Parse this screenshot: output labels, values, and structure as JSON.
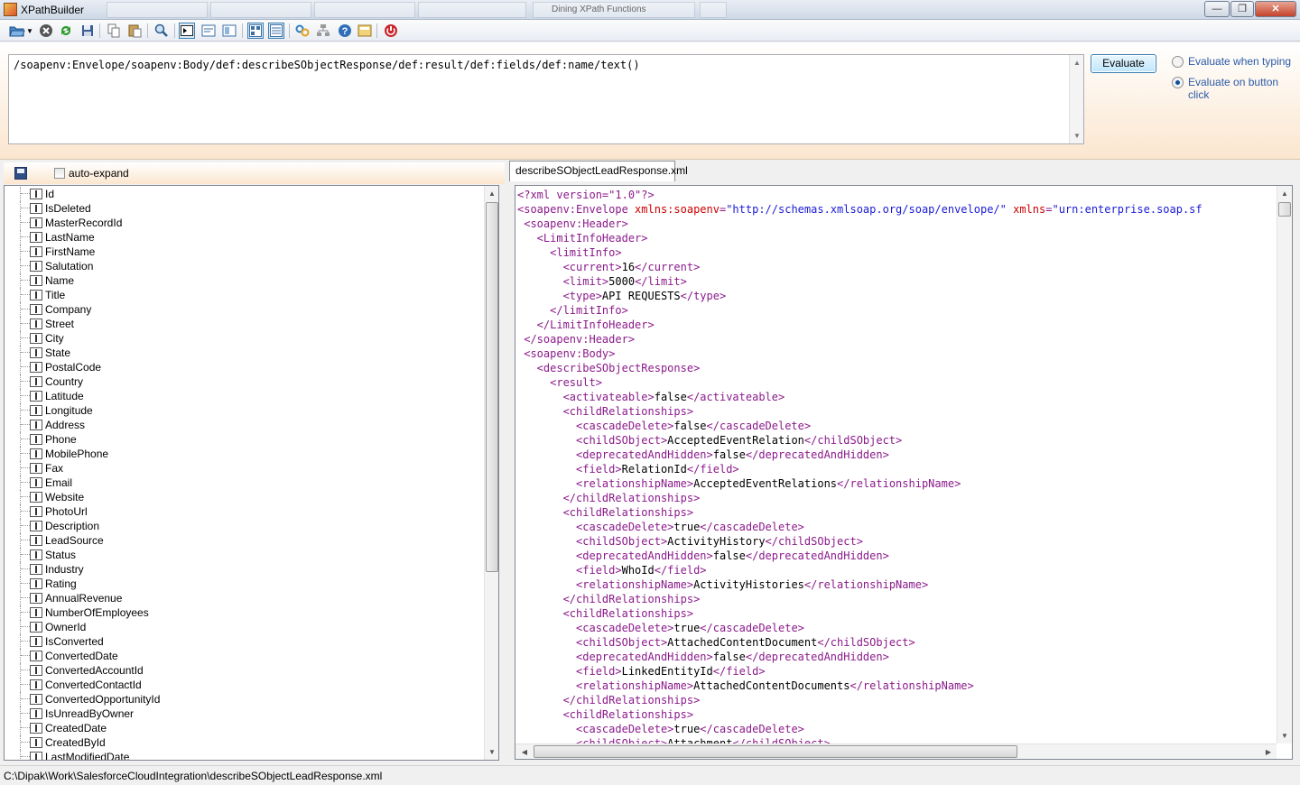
{
  "window": {
    "title": "XPathBuilder",
    "background_tabs": [
      "",
      "",
      "",
      "",
      "Dining XPath Functions",
      ""
    ]
  },
  "toolbar": {
    "icons": [
      "open-folder-icon",
      "close-icon",
      "refresh-icon",
      "save-icon",
      "copy-icon",
      "paste-icon",
      "search-icon",
      "run-xpath-icon",
      "view-icon-1",
      "view-icon-2",
      "layout-icon-1",
      "layout-icon-2",
      "link-icon",
      "network-icon",
      "help-icon",
      "about-icon",
      "power-icon"
    ]
  },
  "xpath": {
    "expression": "/soapenv:Envelope/soapenv:Body/def:describeSObjectResponse/def:result/def:fields/def:name/text()",
    "evaluate_label": "Evaluate",
    "option_typing": "Evaluate when typing",
    "option_button": "Evaluate on button click",
    "selected_option": "button"
  },
  "tree_panel": {
    "auto_expand_label": "auto-expand",
    "auto_expand_checked": false,
    "items": [
      "Id",
      "IsDeleted",
      "MasterRecordId",
      "LastName",
      "FirstName",
      "Salutation",
      "Name",
      "Title",
      "Company",
      "Street",
      "City",
      "State",
      "PostalCode",
      "Country",
      "Latitude",
      "Longitude",
      "Address",
      "Phone",
      "MobilePhone",
      "Fax",
      "Email",
      "Website",
      "PhotoUrl",
      "Description",
      "LeadSource",
      "Status",
      "Industry",
      "Rating",
      "AnnualRevenue",
      "NumberOfEmployees",
      "OwnerId",
      "IsConverted",
      "ConvertedDate",
      "ConvertedAccountId",
      "ConvertedContactId",
      "ConvertedOpportunityId",
      "IsUnreadByOwner",
      "CreatedDate",
      "CreatedById",
      "LastModifiedDate"
    ]
  },
  "document": {
    "tab_label": "describeSObjectLeadResponse.xml",
    "lines": [
      [
        [
          "t",
          "<?xml version=\"1.0\"?>"
        ]
      ],
      [
        [
          "t",
          "<soapenv:Envelope "
        ],
        [
          "a",
          "xmlns:soapenv"
        ],
        [
          "t",
          "="
        ],
        [
          "v",
          "\"http://schemas.xmlsoap.org/soap/envelope/\""
        ],
        [
          "t",
          " "
        ],
        [
          "a",
          "xmlns"
        ],
        [
          "t",
          "="
        ],
        [
          "v",
          "\"urn:enterprise.soap.sf"
        ]
      ],
      [
        [
          "t",
          " <soapenv:Header>"
        ]
      ],
      [
        [
          "t",
          "   <LimitInfoHeader>"
        ]
      ],
      [
        [
          "t",
          "     <limitInfo>"
        ]
      ],
      [
        [
          "t",
          "       <current>"
        ],
        [
          "tx",
          "16"
        ],
        [
          "t",
          "</current>"
        ]
      ],
      [
        [
          "t",
          "       <limit>"
        ],
        [
          "tx",
          "5000"
        ],
        [
          "t",
          "</limit>"
        ]
      ],
      [
        [
          "t",
          "       <type>"
        ],
        [
          "tx",
          "API REQUESTS"
        ],
        [
          "t",
          "</type>"
        ]
      ],
      [
        [
          "t",
          "     </limitInfo>"
        ]
      ],
      [
        [
          "t",
          "   </LimitInfoHeader>"
        ]
      ],
      [
        [
          "t",
          " </soapenv:Header>"
        ]
      ],
      [
        [
          "t",
          " <soapenv:Body>"
        ]
      ],
      [
        [
          "t",
          "   <describeSObjectResponse>"
        ]
      ],
      [
        [
          "t",
          "     <result>"
        ]
      ],
      [
        [
          "t",
          "       <activateable>"
        ],
        [
          "tx",
          "false"
        ],
        [
          "t",
          "</activateable>"
        ]
      ],
      [
        [
          "t",
          "       <childRelationships>"
        ]
      ],
      [
        [
          "t",
          "         <cascadeDelete>"
        ],
        [
          "tx",
          "false"
        ],
        [
          "t",
          "</cascadeDelete>"
        ]
      ],
      [
        [
          "t",
          "         <childSObject>"
        ],
        [
          "tx",
          "AcceptedEventRelation"
        ],
        [
          "t",
          "</childSObject>"
        ]
      ],
      [
        [
          "t",
          "         <deprecatedAndHidden>"
        ],
        [
          "tx",
          "false"
        ],
        [
          "t",
          "</deprecatedAndHidden>"
        ]
      ],
      [
        [
          "t",
          "         <field>"
        ],
        [
          "tx",
          "RelationId"
        ],
        [
          "t",
          "</field>"
        ]
      ],
      [
        [
          "t",
          "         <relationshipName>"
        ],
        [
          "tx",
          "AcceptedEventRelations"
        ],
        [
          "t",
          "</relationshipName>"
        ]
      ],
      [
        [
          "t",
          "       </childRelationships>"
        ]
      ],
      [
        [
          "t",
          "       <childRelationships>"
        ]
      ],
      [
        [
          "t",
          "         <cascadeDelete>"
        ],
        [
          "tx",
          "true"
        ],
        [
          "t",
          "</cascadeDelete>"
        ]
      ],
      [
        [
          "t",
          "         <childSObject>"
        ],
        [
          "tx",
          "ActivityHistory"
        ],
        [
          "t",
          "</childSObject>"
        ]
      ],
      [
        [
          "t",
          "         <deprecatedAndHidden>"
        ],
        [
          "tx",
          "false"
        ],
        [
          "t",
          "</deprecatedAndHidden>"
        ]
      ],
      [
        [
          "t",
          "         <field>"
        ],
        [
          "tx",
          "WhoId"
        ],
        [
          "t",
          "</field>"
        ]
      ],
      [
        [
          "t",
          "         <relationshipName>"
        ],
        [
          "tx",
          "ActivityHistories"
        ],
        [
          "t",
          "</relationshipName>"
        ]
      ],
      [
        [
          "t",
          "       </childRelationships>"
        ]
      ],
      [
        [
          "t",
          "       <childRelationships>"
        ]
      ],
      [
        [
          "t",
          "         <cascadeDelete>"
        ],
        [
          "tx",
          "true"
        ],
        [
          "t",
          "</cascadeDelete>"
        ]
      ],
      [
        [
          "t",
          "         <childSObject>"
        ],
        [
          "tx",
          "AttachedContentDocument"
        ],
        [
          "t",
          "</childSObject>"
        ]
      ],
      [
        [
          "t",
          "         <deprecatedAndHidden>"
        ],
        [
          "tx",
          "false"
        ],
        [
          "t",
          "</deprecatedAndHidden>"
        ]
      ],
      [
        [
          "t",
          "         <field>"
        ],
        [
          "tx",
          "LinkedEntityId"
        ],
        [
          "t",
          "</field>"
        ]
      ],
      [
        [
          "t",
          "         <relationshipName>"
        ],
        [
          "tx",
          "AttachedContentDocuments"
        ],
        [
          "t",
          "</relationshipName>"
        ]
      ],
      [
        [
          "t",
          "       </childRelationships>"
        ]
      ],
      [
        [
          "t",
          "       <childRelationships>"
        ]
      ],
      [
        [
          "t",
          "         <cascadeDelete>"
        ],
        [
          "tx",
          "true"
        ],
        [
          "t",
          "</cascadeDelete>"
        ]
      ],
      [
        [
          "t",
          "         <childSObject>"
        ],
        [
          "tx",
          "Attachment"
        ],
        [
          "t",
          "</childSObject>"
        ]
      ]
    ]
  },
  "status": {
    "path": "C:\\Dipak\\Work\\SalesforceCloudIntegration\\describeSObjectLeadResponse.xml"
  },
  "colors": {
    "tag": "#8b1a8b",
    "attribute": "#cc0000",
    "value": "#1a1ad6",
    "accent": "#3c7fb1",
    "header_gradient": "#fbe6cf"
  }
}
